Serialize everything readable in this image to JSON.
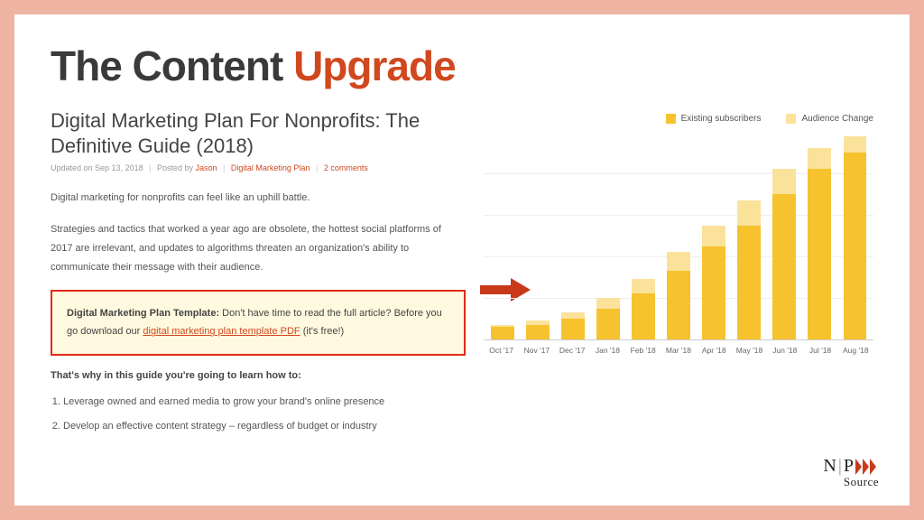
{
  "slide": {
    "title_a": "The Content ",
    "title_b": "Upgrade"
  },
  "article": {
    "title": "Digital Marketing Plan For Nonprofits: The Definitive Guide (2018)",
    "meta_updated": "Updated on Sep 13, 2018",
    "meta_posted": "Posted by ",
    "meta_author": "Jason",
    "meta_cat": "Digital Marketing Plan",
    "meta_comments": "2 comments",
    "p1": "Digital marketing for nonprofits can feel like an uphill battle.",
    "p2": "Strategies and tactics that worked a year ago are obsolete, the hottest social platforms of 2017 are irrelevant, and updates to algorithms threaten an organization's ability to communicate their message with their audience.",
    "callout_b": "Digital Marketing Plan Template:",
    "callout_pre": " Don't have time to read the full article? Before you go download our ",
    "callout_link": "digital marketing plan template PDF",
    "callout_post": " (it's free!)",
    "sub": "That's why in this guide you're going to learn how to:",
    "li1": "Leverage owned and earned media to grow your brand's online presence",
    "li2": "Develop an effective content strategy – regardless of budget or industry"
  },
  "legend": {
    "a": "Existing subscribers",
    "b": "Audience Change"
  },
  "chart_data": {
    "type": "bar",
    "title": "",
    "xlabel": "",
    "ylabel": "",
    "ylim": [
      0,
      100
    ],
    "categories": [
      "Oct '17",
      "Nov '17",
      "Dec '17",
      "Jan '18",
      "Feb '18",
      "Mar '18",
      "Apr '18",
      "May '18",
      "Jun '18",
      "Jul '18",
      "Aug '18"
    ],
    "series": [
      {
        "name": "Existing subscribers",
        "values": [
          6,
          7,
          10,
          15,
          22,
          33,
          45,
          55,
          70,
          82,
          90
        ]
      },
      {
        "name": "Audience Change",
        "values": [
          1,
          2,
          3,
          5,
          7,
          9,
          10,
          12,
          12,
          10,
          8
        ]
      }
    ]
  },
  "logo": {
    "n": "N",
    "p": "P",
    "word": "Source"
  }
}
